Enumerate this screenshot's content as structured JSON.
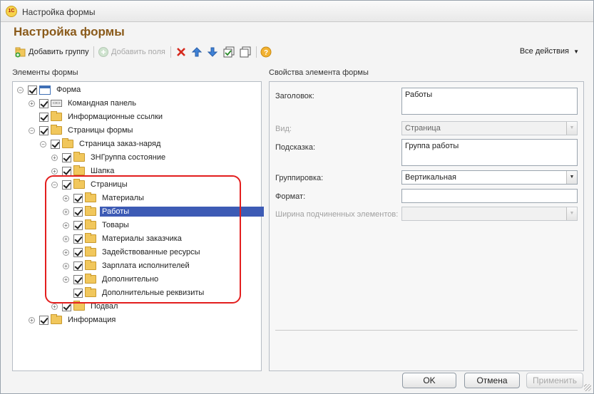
{
  "window": {
    "title": "Настройка формы",
    "app_logo": "1С"
  },
  "form_title": "Настройка формы",
  "toolbar": {
    "add_group": "Добавить группу",
    "add_fields": "Добавить поля",
    "all_actions": "Все действия",
    "icons": [
      "add-group-icon",
      "add-fields-icon",
      "delete-icon",
      "move-up-icon",
      "move-down-icon",
      "check-all-icon",
      "uncheck-all-icon",
      "help-icon"
    ]
  },
  "left_panel": {
    "title": "Элементы формы"
  },
  "right_panel": {
    "title": "Свойства элемента формы"
  },
  "tree": [
    {
      "label": "Форма",
      "icon": "form",
      "expander": "minus",
      "level": 0
    },
    {
      "label": "Командная панель",
      "icon": "command",
      "expander": "plus",
      "level": 1
    },
    {
      "label": "Информационные ссылки",
      "icon": "folder",
      "expander": "none",
      "level": 1
    },
    {
      "label": "Страницы формы",
      "icon": "folder",
      "expander": "minus",
      "level": 1
    },
    {
      "label": "Страница заказ-наряд",
      "icon": "folder",
      "expander": "minus",
      "level": 2
    },
    {
      "label": "ЗНГруппа состояние",
      "icon": "folder",
      "expander": "plus",
      "level": 3
    },
    {
      "label": "Шапка",
      "icon": "folder",
      "expander": "plus",
      "level": 3
    },
    {
      "label": "Страницы",
      "icon": "folder",
      "expander": "minus",
      "level": 3
    },
    {
      "label": "Материалы",
      "icon": "folder",
      "expander": "plus",
      "level": 4
    },
    {
      "label": "Работы",
      "icon": "folder",
      "expander": "plus",
      "level": 4,
      "selected": true
    },
    {
      "label": "Товары",
      "icon": "folder",
      "expander": "plus",
      "level": 4
    },
    {
      "label": "Материалы заказчика",
      "icon": "folder",
      "expander": "plus",
      "level": 4
    },
    {
      "label": "Задействованные ресурсы",
      "icon": "folder",
      "expander": "plus",
      "level": 4
    },
    {
      "label": "Зарплата исполнителей",
      "icon": "folder",
      "expander": "plus",
      "level": 4
    },
    {
      "label": "Дополнительно",
      "icon": "folder",
      "expander": "plus",
      "level": 4
    },
    {
      "label": "Дополнительные реквизиты",
      "icon": "folder",
      "expander": "none",
      "level": 4
    },
    {
      "label": "Подвал",
      "icon": "folder",
      "expander": "plus",
      "level": 3
    },
    {
      "label": "Информация",
      "icon": "folder",
      "expander": "plus",
      "level": 1
    }
  ],
  "properties": {
    "title_label": "Заголовок:",
    "title_value": "Работы",
    "view_label": "Вид:",
    "view_value": "Страница",
    "hint_label": "Подсказка:",
    "hint_value": "Группа работы",
    "grouping_label": "Группировка:",
    "grouping_value": "Вертикальная",
    "format_label": "Формат:",
    "format_value": "",
    "child_width_label": "Ширина подчиненных элементов:",
    "child_width_value": ""
  },
  "buttons": {
    "ok": "OK",
    "cancel": "Отмена",
    "apply": "Применить"
  },
  "colors": {
    "selection": "#3d5bb5",
    "title_brown": "#8a5a1a",
    "highlight_red": "#e31e1e"
  }
}
